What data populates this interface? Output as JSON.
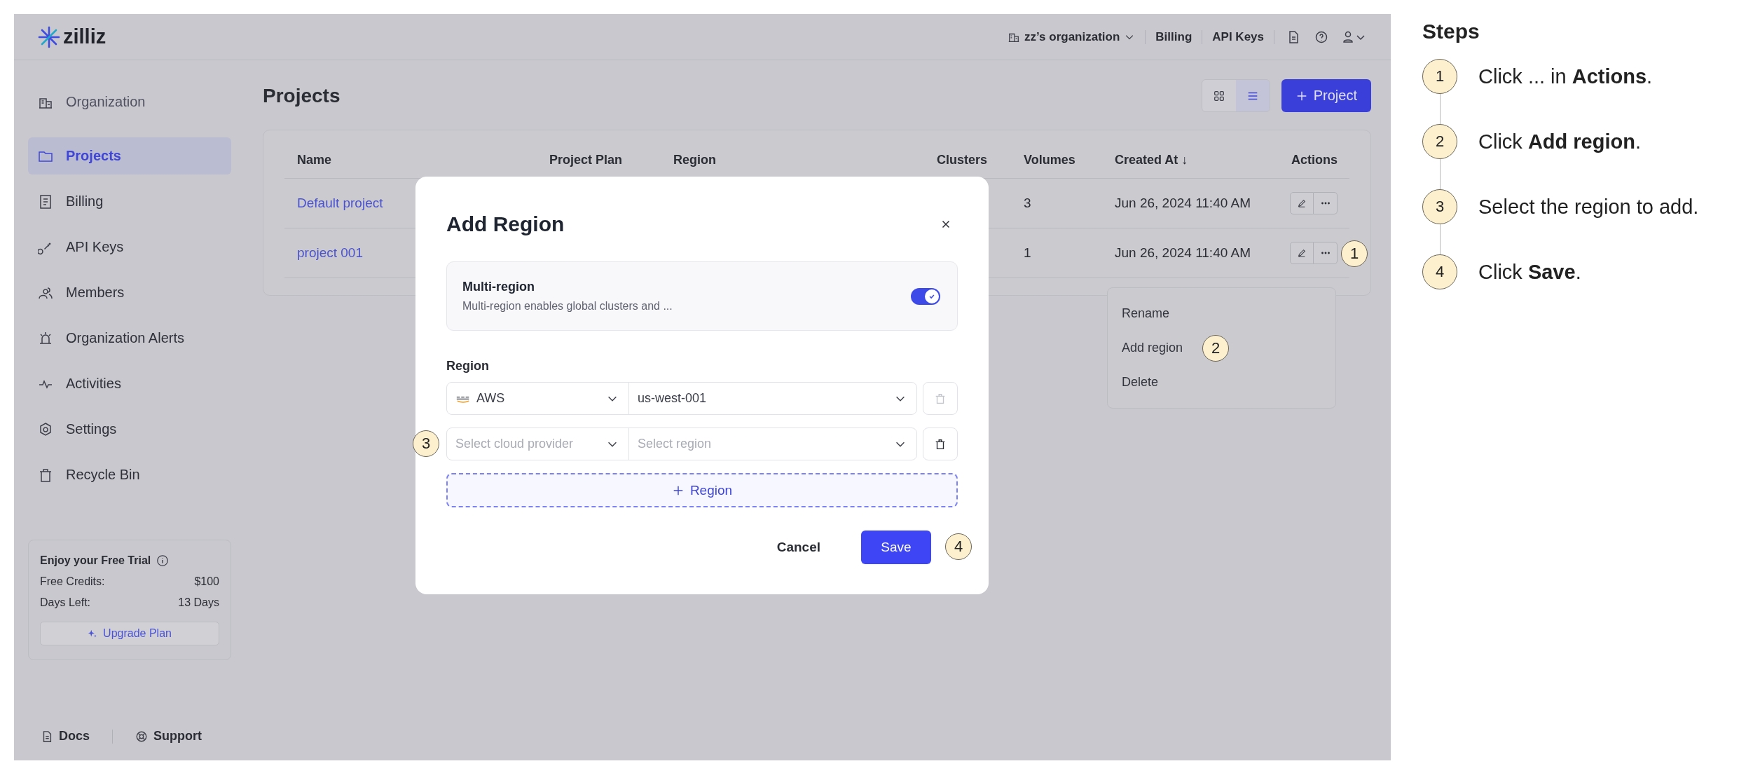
{
  "topbar": {
    "logo": "zilliz",
    "organization": "zz’s organization",
    "links": [
      "Billing",
      "API Keys"
    ]
  },
  "sidebar": {
    "items": [
      {
        "label": "Organization",
        "selected": false
      },
      {
        "label": "Projects",
        "selected": true
      },
      {
        "label": "Billing",
        "selected": false
      },
      {
        "label": "API Keys",
        "selected": false
      },
      {
        "label": "Members",
        "selected": false
      },
      {
        "label": "Organization Alerts",
        "selected": false
      },
      {
        "label": "Activities",
        "selected": false
      },
      {
        "label": "Settings",
        "selected": false
      },
      {
        "label": "Recycle Bin",
        "selected": false
      }
    ],
    "trial": {
      "title": "Enjoy your Free Trial",
      "rows": [
        {
          "label": "Free Credits:",
          "value": "$100"
        },
        {
          "label": "Days Left:",
          "value": "13 Days"
        }
      ],
      "button": "Upgrade Plan"
    },
    "footer": [
      "Docs",
      "Support"
    ]
  },
  "page": {
    "title": "Projects",
    "views": [
      {
        "selected": false
      },
      {
        "selected": true
      }
    ],
    "new_button": "Project"
  },
  "table": {
    "columns": [
      "Name",
      "Project Plan",
      "Region",
      "Clusters",
      "Volumes",
      "Created At ↓",
      "Actions"
    ],
    "rows": [
      {
        "name": "Default project",
        "volumes": "3",
        "created_at": "Jun 26, 2024 11:40 AM"
      },
      {
        "name": "project 001",
        "volumes": "1",
        "created_at": "Jun 26, 2024 11:40 AM"
      }
    ]
  },
  "menu": {
    "items": [
      "Rename",
      "Add region",
      "Delete"
    ]
  },
  "dialog": {
    "title": "Add Region",
    "multi_region": {
      "title": "Multi-region",
      "description": "Multi-region enables global clusters and ...",
      "on": true
    },
    "region_label": "Region",
    "regions": [
      {
        "provider": "AWS",
        "region": "us-west-001",
        "delete_disabled": true
      },
      {
        "provider_placeholder": "Select cloud provider",
        "region_placeholder": "Select region",
        "delete_disabled": false
      }
    ],
    "add_button": "Region",
    "cancel": "Cancel",
    "save": "Save"
  },
  "callouts": [
    "1",
    "2",
    "3",
    "4"
  ],
  "steps": {
    "title": "Steps",
    "items": [
      {
        "number": "1",
        "text": "Click ... in **Actions**."
      },
      {
        "number": "2",
        "text": "Click **Add region**."
      },
      {
        "number": "3",
        "text": "Select the region to add."
      },
      {
        "number": "4",
        "text": "Click **Save**."
      }
    ]
  }
}
